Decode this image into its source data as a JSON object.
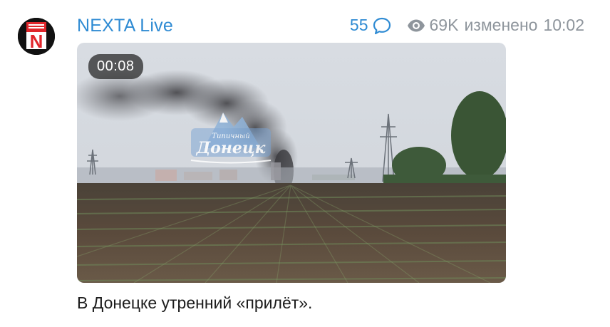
{
  "channel": {
    "name": "NEXTA Live",
    "avatar_letter": "N"
  },
  "post": {
    "comments_count": "55",
    "views": "69K",
    "edited_label": "изменено",
    "time": "10:02",
    "caption": "В Донецке утренний «прилёт»."
  },
  "video": {
    "duration": "00:08",
    "watermark_small": "Типичный",
    "watermark_big": "Донецк"
  },
  "colors": {
    "accent": "#2f8bd3",
    "muted": "#8e959c",
    "avatar_red": "#e0262b"
  },
  "icons": {
    "comments": "comment-bubble-icon",
    "views": "eye-icon"
  }
}
